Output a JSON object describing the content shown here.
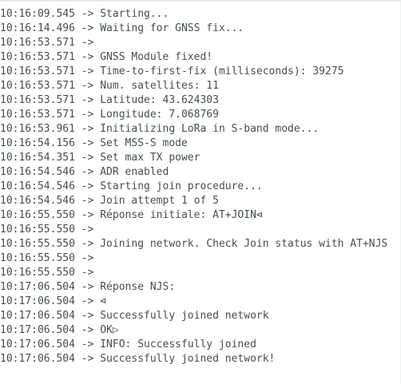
{
  "serial_monitor": {
    "lines": [
      {
        "time": "10:16:09.545",
        "sep": " -> ",
        "text": "Starting..."
      },
      {
        "time": "10:16:14.496",
        "sep": " -> ",
        "text": "Waiting for GNSS fix..."
      },
      {
        "time": "10:16:53.571",
        "sep": " -> ",
        "text": ""
      },
      {
        "time": "10:16:53.571",
        "sep": " -> ",
        "text": "GNSS Module fixed!"
      },
      {
        "time": "10:16:53.571",
        "sep": " -> ",
        "text": "Time-to-first-fix (milliseconds): 39275"
      },
      {
        "time": "10:16:53.571",
        "sep": " -> ",
        "text": "Num. satellites: 11"
      },
      {
        "time": "10:16:53.571",
        "sep": " -> ",
        "text": "Latitude: 43.624303"
      },
      {
        "time": "10:16:53.571",
        "sep": " -> ",
        "text": "Longitude: 7.068769"
      },
      {
        "time": "10:16:53.961",
        "sep": " -> ",
        "text": "Initializing LoRa in S-band mode..."
      },
      {
        "time": "10:16:54.156",
        "sep": " -> ",
        "text": "Set MSS-S mode"
      },
      {
        "time": "10:16:54.351",
        "sep": " -> ",
        "text": "Set max TX power"
      },
      {
        "time": "10:16:54.546",
        "sep": " -> ",
        "text": "ADR enabled"
      },
      {
        "time": "10:16:54.546",
        "sep": " -> ",
        "text": "Starting join procedure..."
      },
      {
        "time": "10:16:54.546",
        "sep": " -> ",
        "text": "Join attempt 1 of 5"
      },
      {
        "time": "10:16:55.550",
        "sep": " -> ",
        "text": "Réponse initiale: AT+JOIN⊲"
      },
      {
        "time": "10:16:55.550",
        "sep": " -> ",
        "text": ""
      },
      {
        "time": "10:16:55.550",
        "sep": " -> ",
        "text": "Joining network. Check Join status with AT+NJS"
      },
      {
        "time": "10:16:55.550",
        "sep": " -> ",
        "text": ""
      },
      {
        "time": "10:16:55.550",
        "sep": " -> ",
        "text": ""
      },
      {
        "time": "10:17:06.504",
        "sep": " -> ",
        "text": "Réponse NJS:"
      },
      {
        "time": "10:17:06.504",
        "sep": " -> ",
        "text": "⊲"
      },
      {
        "time": "10:17:06.504",
        "sep": " -> ",
        "text": "Successfully joined network"
      },
      {
        "time": "10:17:06.504",
        "sep": " -> ",
        "text": "OK▷"
      },
      {
        "time": "10:17:06.504",
        "sep": " -> ",
        "text": "INFO: Successfully joined"
      },
      {
        "time": "10:17:06.504",
        "sep": " -> ",
        "text": "Successfully joined network!"
      }
    ]
  }
}
